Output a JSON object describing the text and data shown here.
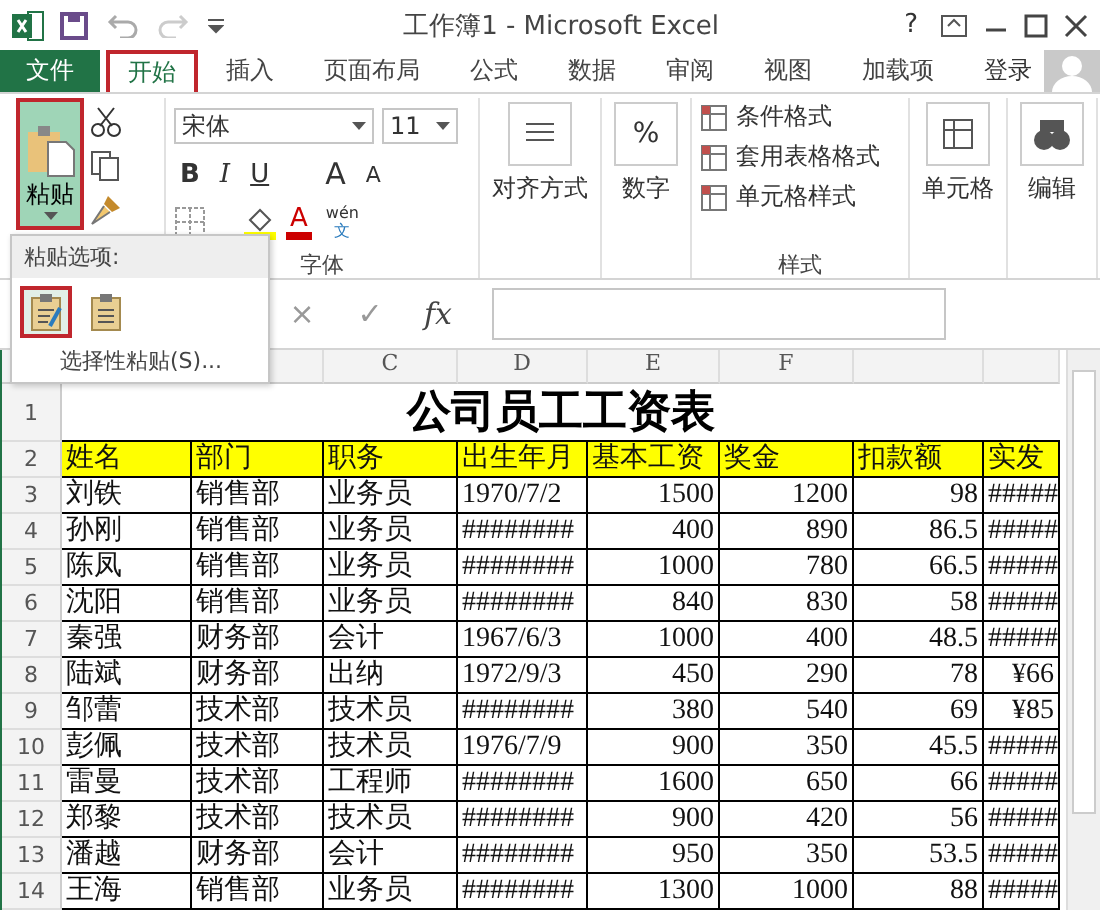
{
  "window": {
    "title": "工作簿1 - Microsoft Excel",
    "help": "?"
  },
  "tabs": [
    {
      "label": "文件",
      "kind": "file",
      "selected": false
    },
    {
      "label": "开始",
      "kind": "tab",
      "selected": true
    },
    {
      "label": "插入",
      "kind": "tab",
      "selected": false
    },
    {
      "label": "页面布局",
      "kind": "tab",
      "selected": false
    },
    {
      "label": "公式",
      "kind": "tab",
      "selected": false
    },
    {
      "label": "数据",
      "kind": "tab",
      "selected": false
    },
    {
      "label": "审阅",
      "kind": "tab",
      "selected": false
    },
    {
      "label": "视图",
      "kind": "tab",
      "selected": false
    },
    {
      "label": "加载项",
      "kind": "tab",
      "selected": false
    }
  ],
  "account": {
    "label": "登录"
  },
  "ribbon": {
    "paste": {
      "label": "粘贴",
      "pressed": true
    },
    "font": {
      "name": "宋体",
      "size": "11",
      "bold": "B",
      "italic": "I",
      "underline": "U",
      "grow": "A",
      "shrink": "A",
      "font_color": "A",
      "phonetic_top": "wén",
      "phonetic_bottom": "文",
      "group_label": "字体"
    },
    "alignment": "对齐方式",
    "number": {
      "symbol": "%",
      "label": "数字"
    },
    "styles": {
      "items": [
        "条件格式",
        "套用表格格式",
        "单元格样式"
      ],
      "group_label": "样式"
    },
    "cells": "单元格",
    "editing": "编辑"
  },
  "paste_menu": {
    "title": "粘贴选项:",
    "options": [
      {
        "kind": "keep-format",
        "selected": true
      },
      {
        "kind": "plain",
        "selected": false
      }
    ],
    "special": "选择性粘贴(S)..."
  },
  "formula_bar": {
    "cancel": "×",
    "enter": "✓",
    "fx": "fx"
  },
  "columns": [
    "",
    "",
    "C",
    "D",
    "E",
    "F",
    "",
    ""
  ],
  "sheet": {
    "title_row": "1",
    "title": "公司员工工资表",
    "header": {
      "number": "2",
      "cells": [
        "姓名",
        "部门",
        "职务",
        "出生年月",
        "基本工资",
        "奖金",
        "扣款额",
        "实发"
      ]
    },
    "rows": [
      {
        "number": "3",
        "cells": [
          "刘铁",
          "销售部",
          "业务员",
          "1970/7/2",
          "1500",
          "1200",
          "98",
          "#####"
        ]
      },
      {
        "number": "4",
        "cells": [
          "孙刚",
          "销售部",
          "业务员",
          "########",
          "400",
          "890",
          "86.5",
          "#####"
        ]
      },
      {
        "number": "5",
        "cells": [
          "陈凤",
          "销售部",
          "业务员",
          "########",
          "1000",
          "780",
          "66.5",
          "#####"
        ]
      },
      {
        "number": "6",
        "cells": [
          "沈阳",
          "销售部",
          "业务员",
          "########",
          "840",
          "830",
          "58",
          "#####"
        ]
      },
      {
        "number": "7",
        "cells": [
          "秦强",
          "财务部",
          "会计",
          "1967/6/3",
          "1000",
          "400",
          "48.5",
          "#####"
        ]
      },
      {
        "number": "8",
        "cells": [
          "陆斌",
          "财务部",
          "出纳",
          "1972/9/3",
          "450",
          "290",
          "78",
          "¥66"
        ]
      },
      {
        "number": "9",
        "cells": [
          "邹蕾",
          "技术部",
          "技术员",
          "########",
          "380",
          "540",
          "69",
          "¥85"
        ]
      },
      {
        "number": "10",
        "cells": [
          "彭佩",
          "技术部",
          "技术员",
          "1976/7/9",
          "900",
          "350",
          "45.5",
          "#####"
        ]
      },
      {
        "number": "11",
        "cells": [
          "雷曼",
          "技术部",
          "工程师",
          "########",
          "1600",
          "650",
          "66",
          "#####"
        ]
      },
      {
        "number": "12",
        "cells": [
          "郑黎",
          "技术部",
          "技术员",
          "########",
          "900",
          "420",
          "56",
          "#####"
        ]
      },
      {
        "number": "13",
        "cells": [
          "潘越",
          "财务部",
          "会计",
          "########",
          "950",
          "350",
          "53.5",
          "#####"
        ]
      },
      {
        "number": "14",
        "cells": [
          "王海",
          "销售部",
          "业务员",
          "########",
          "1300",
          "1000",
          "88",
          "#####"
        ]
      }
    ]
  }
}
